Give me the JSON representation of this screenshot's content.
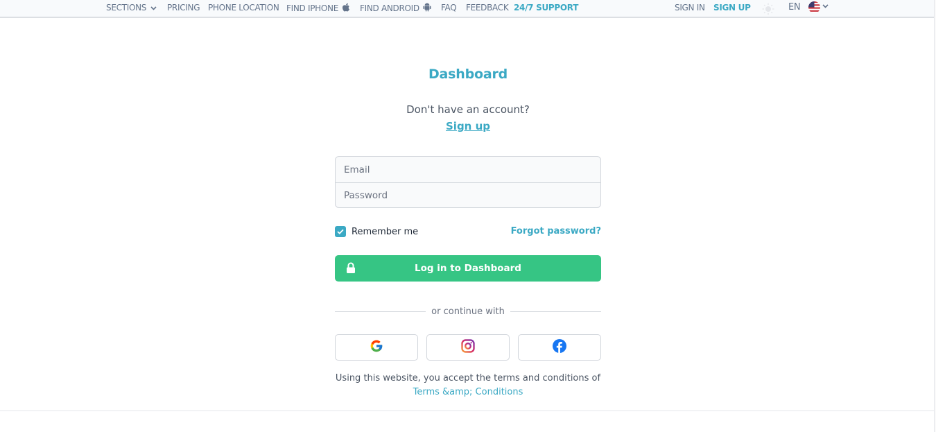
{
  "nav": {
    "sections": "SECTIONS",
    "pricing": "PRICING",
    "phone_location": "PHONE LOCATION",
    "find_iphone": "FIND IPHONE",
    "find_android": "FIND ANDROID",
    "faq": "FAQ",
    "feedback": "FEEDBACK",
    "support": "24/7 SUPPORT",
    "sign_in": "SIGN IN",
    "sign_up": "SIGN UP",
    "language": "EN",
    "icons": {
      "sections": "chevron-down-icon",
      "find_iphone": "apple-icon",
      "find_android": "android-icon",
      "theme": "sun-icon",
      "flag": "us-flag-icon",
      "language_menu": "chevron-down-icon"
    }
  },
  "login": {
    "title": "Dashboard",
    "no_account": "Don't have an account?",
    "signup_link": "Sign up",
    "email_placeholder": "Email",
    "email_value": "",
    "password_placeholder": "Password",
    "password_value": "",
    "remember_label": "Remember me",
    "remember_checked": true,
    "forgot_label": "Forgot password?",
    "submit_label": "Log in to Dashboard",
    "submit_icon": "lock-icon",
    "divider_text": "or continue with",
    "social": [
      {
        "name": "Google",
        "icon": "google-icon"
      },
      {
        "name": "Instagram",
        "icon": "instagram-icon"
      },
      {
        "name": "Facebook",
        "icon": "facebook-icon"
      }
    ],
    "terms_text": "Using this website, you accept the terms and conditions of",
    "terms_link": "Terms &amp; Conditions"
  },
  "colors": {
    "accent": "#3ba9c4",
    "primary_button": "#36c584",
    "nav_text": "#64748b",
    "facebook": "#1877f2"
  }
}
